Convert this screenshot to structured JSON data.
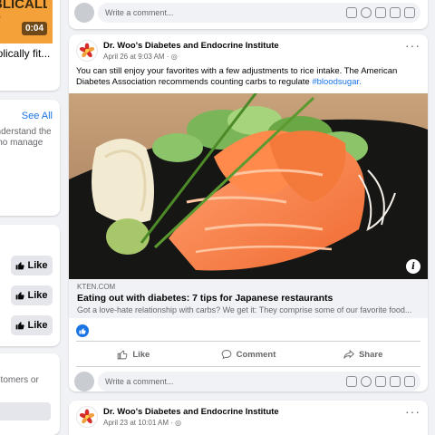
{
  "left_video": {
    "thumb_text": "BLICALLY\n?",
    "duration": "0:04",
    "title": "bolically fit..."
  },
  "left_panel": {
    "see_all": "See All",
    "desc": "understand the\nwho manage"
  },
  "left_likes": {
    "like_label": "Like"
  },
  "left_bottom": {
    "text": "ustomers or"
  },
  "comment_placeholder": "Write a comment...",
  "post": {
    "author": "Dr. Woo's Diabetes and Endocrine Institute",
    "meta": "April 26 at 9:03 AM · ",
    "body_text": "You can still enjoy your favorites with a few adjustments to rice intake. The American Diabetes Association recommends counting carbs to regulate ",
    "hashtag": "#bloodsugar.",
    "link": {
      "domain": "KTEN.COM",
      "title": "Eating out with diabetes: 7 tips for Japanese restaurants",
      "desc": "Got a love-hate relationship with carbs? We get it: They comprise some of our favorite food..."
    },
    "actions": {
      "like": "Like",
      "comment": "Comment",
      "share": "Share"
    }
  },
  "post2": {
    "author": "Dr. Woo's Diabetes and Endocrine Institute",
    "meta": "April 23 at 10:01 AM · "
  },
  "colors": {
    "accent": "#1b74e4",
    "logo_red": "#d62b2b",
    "logo_orange": "#f2a03d",
    "video_orange": "#f5a13a"
  }
}
